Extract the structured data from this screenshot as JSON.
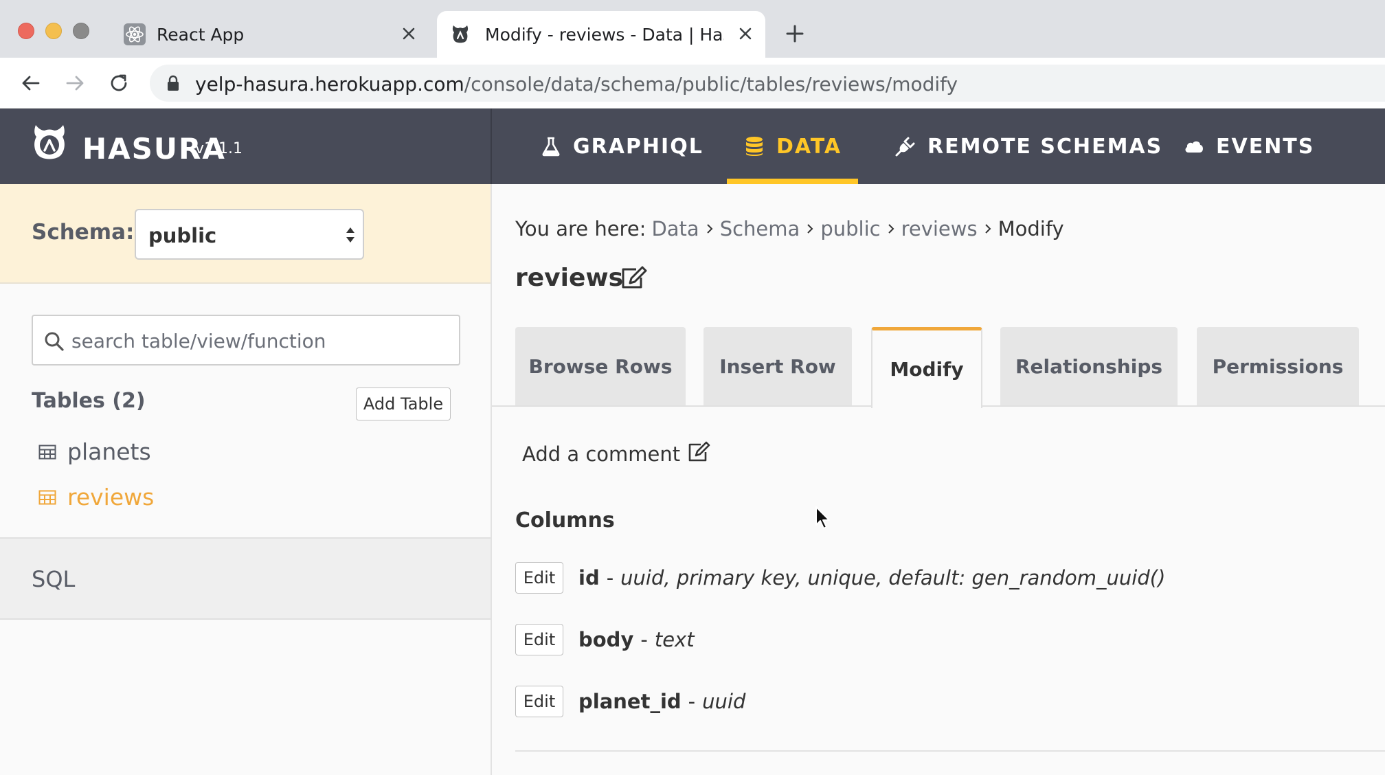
{
  "browser": {
    "tabs": [
      {
        "title": "React App",
        "icon": "react-icon",
        "active": false
      },
      {
        "title": "Modify - reviews - Data | Hasura",
        "icon": "hasura-icon",
        "active": true
      }
    ],
    "url_host": "yelp-hasura.herokuapp.com",
    "url_path": "/console/data/schema/public/tables/reviews/modify"
  },
  "header": {
    "brand": "HASURA",
    "version": "v1.1.1",
    "nav": [
      {
        "label": "GRAPHIQL",
        "icon": "flask-icon",
        "active": false
      },
      {
        "label": "DATA",
        "icon": "database-icon",
        "active": true
      },
      {
        "label": "REMOTE SCHEMAS",
        "icon": "plug-icon",
        "active": false
      },
      {
        "label": "EVENTS",
        "icon": "cloud-icon",
        "active": false
      }
    ],
    "active_color": "#ffc627"
  },
  "sidebar": {
    "schema_label": "Schema:",
    "schema_value": "public",
    "search_placeholder": "search table/view/function",
    "tables_title": "Tables (2)",
    "add_table_label": "Add Table",
    "tables": [
      {
        "name": "planets",
        "active": false
      },
      {
        "name": "reviews",
        "active": true
      }
    ],
    "sql_label": "SQL",
    "accent_color": "#f0a73a"
  },
  "main": {
    "breadcrumb": {
      "prefix": "You are here:",
      "items": [
        "Data",
        "Schema",
        "public",
        "reviews"
      ],
      "current": "Modify"
    },
    "title": "reviews",
    "tabs": [
      {
        "label": "Browse Rows",
        "active": false
      },
      {
        "label": "Insert Row",
        "active": false
      },
      {
        "label": "Modify",
        "active": true
      },
      {
        "label": "Relationships",
        "active": false
      },
      {
        "label": "Permissions",
        "active": false
      }
    ],
    "add_comment": "Add a comment",
    "columns_title": "Columns",
    "columns": [
      {
        "edit_label": "Edit",
        "name": "id",
        "desc": "uuid, primary key, unique, default: gen_random_uuid()"
      },
      {
        "edit_label": "Edit",
        "name": "body",
        "desc": "text"
      },
      {
        "edit_label": "Edit",
        "name": "planet_id",
        "desc": "uuid"
      }
    ]
  }
}
